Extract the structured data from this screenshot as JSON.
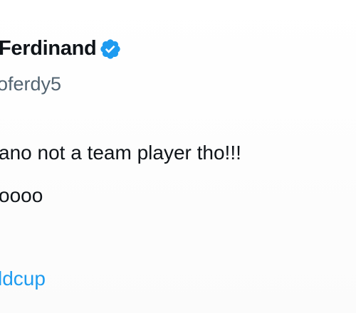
{
  "tweet": {
    "author_name": "Ferdinand",
    "author_handle": "oferdy5",
    "verified_icon": "verified-badge-icon",
    "text_lines": [
      "ano not a team player tho!!!",
      "oooo"
    ],
    "hashtag": "ldcup"
  },
  "colors": {
    "text": "#0f1419",
    "handle": "#536471",
    "link": "#1d9bf0",
    "badge": "#1d9bf0"
  }
}
